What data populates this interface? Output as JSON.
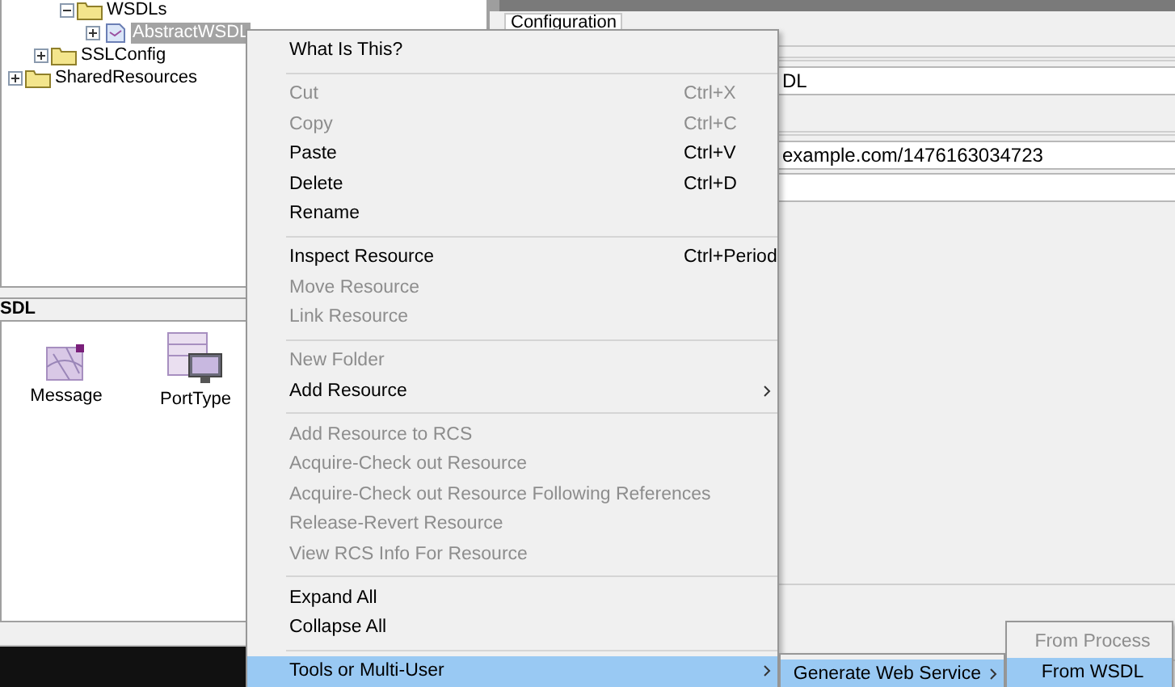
{
  "tree": {
    "items": [
      {
        "children": [
          {
            "children": [
              {
                "label": "WSDLs",
                "kind": "folder",
                "expanded": true,
                "selected": false,
                "children": [
                  {
                    "label": "AbstractWSDL",
                    "kind": "wsdl",
                    "expanded": false,
                    "selected": true
                  }
                ]
              }
            ]
          },
          {
            "label": "SSLConfig",
            "kind": "folder",
            "expanded": false,
            "selected": false
          }
        ]
      },
      {
        "label": "SharedResources",
        "kind": "folder",
        "expanded": false,
        "selected": false
      }
    ]
  },
  "palette": {
    "title": "SDL",
    "items": [
      {
        "label": "Message",
        "kind": "message"
      },
      {
        "label": "PortType",
        "kind": "porttype"
      }
    ]
  },
  "editor": {
    "tab": "Configuration",
    "fields": [
      {
        "kind": "text",
        "value": "DL"
      },
      {
        "kind": "text",
        "value": "example.com/1476163034723"
      },
      {
        "kind": "text"
      }
    ]
  },
  "context_menu": {
    "items": [
      {
        "kind": "item",
        "label": "What Is This?",
        "disabled": false,
        "highlighted": false,
        "submenu": false
      },
      {
        "kind": "separator"
      },
      {
        "kind": "item",
        "label": "Cut",
        "shortcut": "Ctrl+X",
        "disabled": true,
        "highlighted": false,
        "submenu": false
      },
      {
        "kind": "item",
        "label": "Copy",
        "shortcut": "Ctrl+C",
        "disabled": true,
        "highlighted": false,
        "submenu": false
      },
      {
        "kind": "item",
        "label": "Paste",
        "shortcut": "Ctrl+V",
        "disabled": false,
        "highlighted": false,
        "submenu": false
      },
      {
        "kind": "item",
        "label": "Delete",
        "shortcut": "Ctrl+D",
        "disabled": false,
        "highlighted": false,
        "submenu": false
      },
      {
        "kind": "item",
        "label": "Rename",
        "disabled": false,
        "highlighted": false,
        "submenu": false
      },
      {
        "kind": "separator"
      },
      {
        "kind": "item",
        "label": "Inspect Resource",
        "shortcut": "Ctrl+Period",
        "disabled": false,
        "highlighted": false,
        "submenu": false
      },
      {
        "kind": "item",
        "label": "Move Resource",
        "disabled": true,
        "highlighted": false,
        "submenu": false
      },
      {
        "kind": "item",
        "label": "Link Resource",
        "disabled": true,
        "highlighted": false,
        "submenu": false
      },
      {
        "kind": "separator"
      },
      {
        "kind": "item",
        "label": "New Folder",
        "disabled": true,
        "highlighted": false,
        "submenu": false
      },
      {
        "kind": "item",
        "label": "Add Resource",
        "disabled": false,
        "highlighted": false,
        "submenu": true
      },
      {
        "kind": "separator"
      },
      {
        "kind": "item",
        "label": "Add Resource to RCS",
        "disabled": true,
        "highlighted": false,
        "submenu": false
      },
      {
        "kind": "item",
        "label": "Acquire-Check out Resource",
        "disabled": true,
        "highlighted": false,
        "submenu": false
      },
      {
        "kind": "item",
        "label": "Acquire-Check out Resource Following References",
        "disabled": true,
        "highlighted": false,
        "submenu": false
      },
      {
        "kind": "item",
        "label": "Release-Revert Resource",
        "disabled": true,
        "highlighted": false,
        "submenu": false
      },
      {
        "kind": "item",
        "label": "View RCS Info For Resource",
        "disabled": true,
        "highlighted": false,
        "submenu": false
      },
      {
        "kind": "separator"
      },
      {
        "kind": "item",
        "label": "Expand All",
        "disabled": false,
        "highlighted": false,
        "submenu": false
      },
      {
        "kind": "item",
        "label": "Collapse All",
        "disabled": false,
        "highlighted": false,
        "submenu": false
      },
      {
        "kind": "separator"
      },
      {
        "kind": "item",
        "label": "Tools or Multi-User",
        "disabled": false,
        "highlighted": true,
        "submenu": true
      }
    ]
  },
  "submenu": {
    "items": [
      {
        "kind": "item",
        "label": "Generate Web Service",
        "disabled": false,
        "highlighted": true,
        "submenu": true
      }
    ]
  },
  "submenu_2": {
    "items": [
      {
        "kind": "item",
        "label": "From Process",
        "disabled": true,
        "highlighted": false,
        "submenu": false
      },
      {
        "kind": "item",
        "label": "From WSDL",
        "disabled": false,
        "highlighted": true,
        "submenu": false
      }
    ]
  }
}
